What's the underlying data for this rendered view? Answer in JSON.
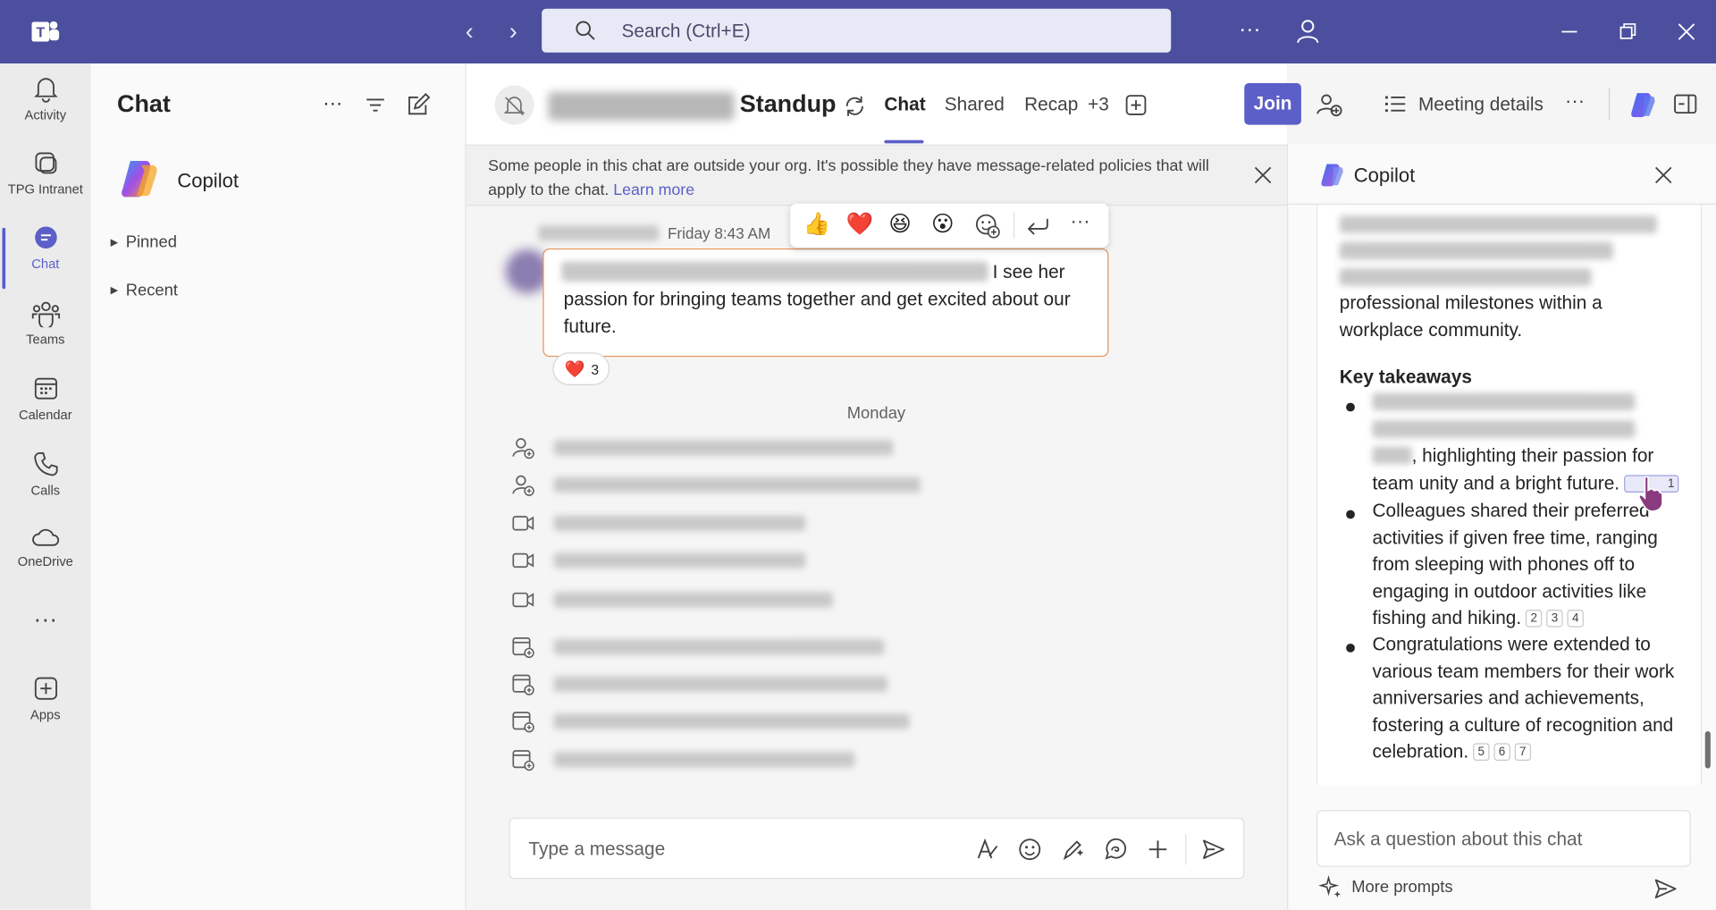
{
  "titlebar": {
    "search_placeholder": "Search (Ctrl+E)"
  },
  "rail": {
    "items": [
      {
        "label": "Activity",
        "icon": "bell-icon"
      },
      {
        "label": "TPG Intranet",
        "icon": "intranet-icon"
      },
      {
        "label": "Chat",
        "icon": "chat-icon",
        "active": true
      },
      {
        "label": "Teams",
        "icon": "teams-icon"
      },
      {
        "label": "Calendar",
        "icon": "calendar-icon"
      },
      {
        "label": "Calls",
        "icon": "phone-icon"
      },
      {
        "label": "OneDrive",
        "icon": "cloud-icon"
      },
      {
        "label": "Apps",
        "icon": "add-app-icon"
      }
    ]
  },
  "chatlist": {
    "title": "Chat",
    "copilot_label": "Copilot",
    "pinned_label": "Pinned",
    "recent_label": "Recent"
  },
  "header": {
    "title_suffix": "Standup",
    "tabs": [
      "Chat",
      "Shared",
      "Recap",
      "+3"
    ],
    "join_label": "Join",
    "meeting_details_label": "Meeting details"
  },
  "banner": {
    "text": "Some people in this chat are outside your org. It's possible they have message-related policies that will apply to the chat.",
    "link": "Learn more"
  },
  "message": {
    "time": "Friday 8:43 AM",
    "visible_text": "I see her passion for bringing teams together and get excited about our future.",
    "reaction_emoji": "❤️",
    "reaction_count": "3"
  },
  "reaction_bar": [
    "👍",
    "❤️",
    "😆",
    "😮"
  ],
  "day_separator": "Monday",
  "composer": {
    "placeholder": "Type a message"
  },
  "copilot": {
    "title": "Copilot",
    "intro_tail": "professional milestones within a workplace community.",
    "takeaways_heading": "Key takeaways",
    "bullets": [
      {
        "text": ", highlighting their passion for team unity and a bright future.",
        "refs": [
          "1"
        ]
      },
      {
        "text": "Colleagues shared their preferred activities if given free time, ranging from sleeping with phones off to engaging in outdoor activities like fishing and hiking.",
        "refs": [
          "2",
          "3",
          "4"
        ]
      },
      {
        "text": "Congratulations were extended to various team members for their work anniversaries and achievements, fostering a culture of recognition and celebration.",
        "refs": [
          "5",
          "6",
          "7"
        ]
      }
    ],
    "input_placeholder": "Ask a question about this chat",
    "more_prompts_label": "More prompts"
  },
  "colors": {
    "titlebar": "#4b4f9e",
    "accent": "#5b5fc7",
    "highlight_border": "#e4935a"
  }
}
